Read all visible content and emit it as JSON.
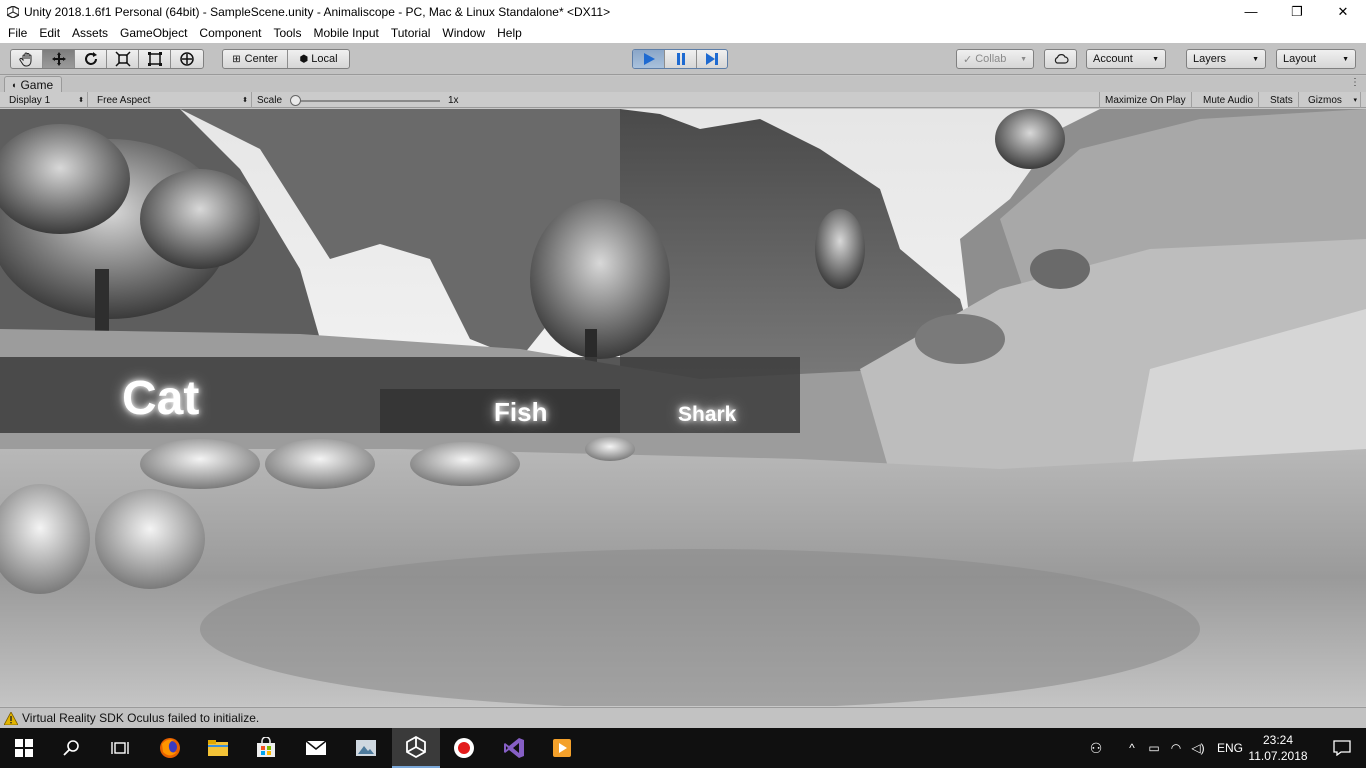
{
  "window": {
    "title": "Unity 2018.1.6f1 Personal (64bit) - SampleScene.unity - Animaliscope - PC, Mac & Linux Standalone* <DX11>",
    "minimize": "—",
    "maximize": "❐",
    "close": "✕"
  },
  "menu": [
    "File",
    "Edit",
    "Assets",
    "GameObject",
    "Component",
    "Tools",
    "Mobile Input",
    "Tutorial",
    "Window",
    "Help"
  ],
  "toolbar": {
    "pivot_mode": "Center",
    "pivot_rotation": "Local",
    "collab": "Collab",
    "account": "Account",
    "layers": "Layers",
    "layout": "Layout"
  },
  "game_tab": {
    "label": "Game",
    "display": "Display 1",
    "aspect": "Free Aspect",
    "scale_label": "Scale",
    "scale_value": "1x",
    "maximize_on_play": "Maximize On Play",
    "mute_audio": "Mute Audio",
    "stats": "Stats",
    "gizmos": "Gizmos"
  },
  "scene_labels": {
    "word1": "Cat",
    "word2": "Fish",
    "word3": "Shark"
  },
  "status": {
    "message": "Virtual Reality SDK Oculus failed to initialize."
  },
  "taskbar": {
    "language": "ENG",
    "time": "23:24",
    "date": "11.07.2018"
  },
  "colors": {
    "editor_bg": "#c2c2c2",
    "play_active": "#8aa6c8",
    "play_icon": "#1e6ad1",
    "taskbar_bg": "#101010"
  }
}
